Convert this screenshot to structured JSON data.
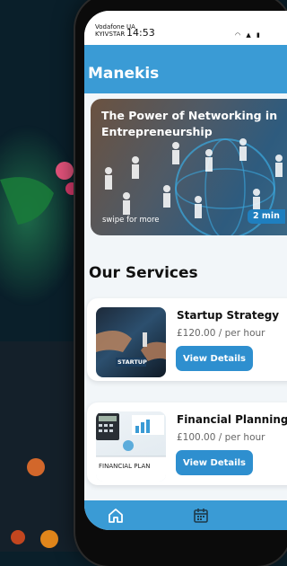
{
  "statusbar": {
    "carrier_line1": "Vodafone UA",
    "carrier_line2": "KYIVSTAR",
    "time": "14:53",
    "icons": [
      "wifi-icon",
      "signal-icon",
      "battery-icon"
    ]
  },
  "app": {
    "title": "Manekis"
  },
  "hero": {
    "title": "The Power of Networking in Entrepreneurship",
    "hint": "swipe for more",
    "read_time": "2 min"
  },
  "services": {
    "heading": "Our Services",
    "items": [
      {
        "title": "Startup Strategy",
        "price": "£120.00 / per hour",
        "button": "View Details",
        "image_label": "STARTUP"
      },
      {
        "title": "Financial Planning",
        "price": "£100.00 / per hour",
        "button": "View Details",
        "image_label": "FINANCIAL PLAN"
      }
    ]
  },
  "bottom_nav": {
    "items": [
      "home-icon",
      "calendar-icon"
    ]
  },
  "colors": {
    "primary": "#3a9bd5",
    "button": "#2e8fcf",
    "background": "#f2f6f9"
  }
}
